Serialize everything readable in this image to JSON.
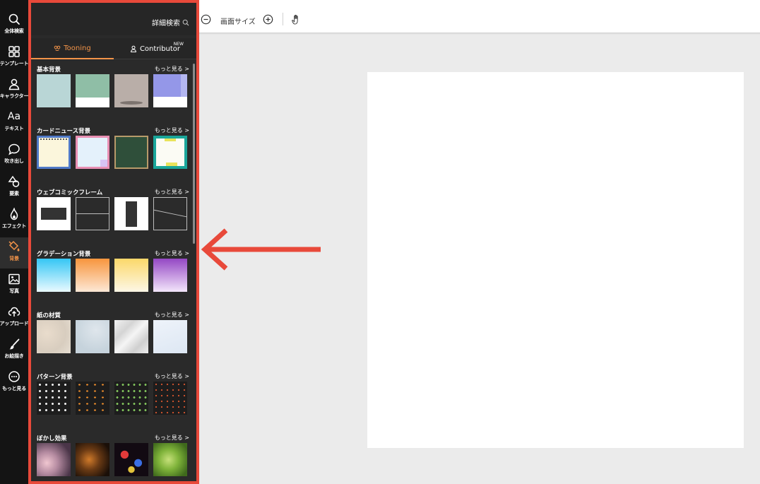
{
  "rail": {
    "items": [
      {
        "label": "全体検索",
        "icon": "search-icon"
      },
      {
        "label": "テンプレート",
        "icon": "grid-icon"
      },
      {
        "label": "キャラクター",
        "icon": "user-icon"
      },
      {
        "label": "テキスト",
        "icon": "text-icon",
        "glyph": "Aa"
      },
      {
        "label": "吹き出し",
        "icon": "speech-bubble-icon"
      },
      {
        "label": "要素",
        "icon": "shapes-icon"
      },
      {
        "label": "エフェクト",
        "icon": "flame-icon"
      },
      {
        "label": "背景",
        "icon": "paint-bucket-icon",
        "active": true
      },
      {
        "label": "写真",
        "icon": "photo-icon"
      },
      {
        "label": "アップロード",
        "icon": "cloud-upload-icon"
      },
      {
        "label": "お絵描き",
        "icon": "brush-icon"
      },
      {
        "label": "もっと見る",
        "icon": "more-icon"
      }
    ]
  },
  "panel": {
    "search_label": "詳細検索",
    "tabs": [
      {
        "label": "Tooning",
        "icon": "tooning-logo-icon",
        "active": true
      },
      {
        "label": "Contributor",
        "icon": "user-icon"
      }
    ],
    "new_badge": "NEW",
    "sections": [
      {
        "title": "基本背景",
        "more": "もっと見る >"
      },
      {
        "title": "カードニュース背景",
        "more": "もっと見る >"
      },
      {
        "title": "ウェブコミックフレーム",
        "more": "もっと見る >"
      },
      {
        "title": "グラデーション背景",
        "more": "もっと見る >"
      },
      {
        "title": "紙の材質",
        "more": "もっと見る >"
      },
      {
        "title": "パターン背景",
        "more": "もっと見る >"
      },
      {
        "title": "ぼかし効果",
        "more": "もっと見る >"
      }
    ]
  },
  "toolbar": {
    "zoom_label": "画面サイズ",
    "zoom_out_icon": "minus-circle-icon",
    "zoom_in_icon": "plus-circle-icon",
    "pan_icon": "hand-icon"
  },
  "colors": {
    "accent": "#f39449",
    "highlight": "#e8493a",
    "rail_bg": "#141414",
    "panel_bg": "#2a2a2a",
    "workspace_bg": "#ebebeb"
  }
}
